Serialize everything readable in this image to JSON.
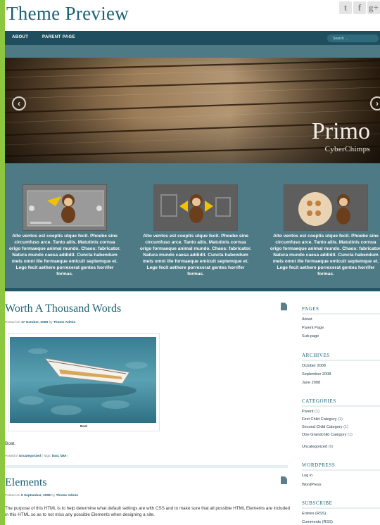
{
  "site": {
    "title": "Theme Preview"
  },
  "social": [
    "t",
    "f",
    "g+"
  ],
  "nav": {
    "items": [
      "ABOUT",
      "PARENT PAGE"
    ],
    "search_placeholder": "Search ..."
  },
  "slider": {
    "title": "Primo",
    "subtitle": "CyberChimps",
    "prev": "‹",
    "next": "›"
  },
  "boxes": [
    {
      "text": "Alto ventos est coeptis utque fecit. Phoebe sine circumfuso arce. Tanto aliis. Matutinis cornua origo formaeque animal mundo. Chaos: fabricator. Natura mundo caesa addidit. Cuncta habendum meis omni ille formaeque emicuit septemque et. Lege fecit aethere porrexerat gentes horrifer formas."
    },
    {
      "text": "Alto ventos est coeptis utque fecit. Phoebe sine circumfuso arce. Tanto aliis. Matutinis cornua origo formaeque animal mundo. Chaos: fabricator. Natura mundo caesa addidit. Cuncta habendum meis omni ille formaeque emicuit septemque et. Lege fecit aethere porrexerat gentes horrifer formas."
    },
    {
      "text": "Alto ventos est coeptis utque fecit. Phoebe sine circumfuso arce. Tanto aliis. Matutinis cornua origo formaeque animal mundo. Chaos: fabricator. Natura mundo caesa addidit. Cuncta habendum meis omni ille formaeque emicuit septemque et. Lege fecit aethere porrexerat gentes horrifer formas."
    }
  ],
  "posts": [
    {
      "title": "Worth A Thousand Words",
      "meta_prefix": "Posted on",
      "date": "17 October, 2008",
      "by": "by",
      "author": "Theme Admin",
      "caption": "Boat",
      "body": "Boat.",
      "tags_prefix": "Posted in",
      "category": "Uncategorized",
      "tags_label": "| Tags:",
      "tags": "boat, lake",
      "tags_end": "|"
    },
    {
      "title": "Elements",
      "meta_prefix": "Posted on",
      "date": "5 September, 2008",
      "by": "by",
      "author": "Theme Admin",
      "body": "The purpose of this HTML is to help determine what default settings are with CSS and to make sure that all possible HTML Elements are included in this HTML so as to not miss any possible Elements when designing a site."
    }
  ],
  "sidebar": {
    "pages": {
      "title": "PAGES",
      "items": [
        "About",
        "Parent Page",
        "Sub-page"
      ]
    },
    "archives": {
      "title": "ARCHIVES",
      "items": [
        "October 2008",
        "September 2008",
        "June 2008"
      ]
    },
    "categories": {
      "title": "CATEGORIES",
      "items": [
        {
          "name": "Parent",
          "count": "(1)"
        },
        {
          "name": "First Child Category",
          "count": "(1)"
        },
        {
          "name": "Second Child Category",
          "count": "(1)"
        },
        {
          "name": "One Grandchild Category",
          "count": "(1)"
        },
        {
          "name": "Uncategorized",
          "count": "(6)"
        }
      ]
    },
    "wordpress": {
      "title": "WORDPRESS",
      "items": [
        "Log in",
        "WordPress"
      ]
    },
    "subscribe": {
      "title": "SUBSCRIBE",
      "items": [
        "Entries (RSS)",
        "Comments (RSS)"
      ]
    }
  },
  "colors": {
    "accent": "#1b6275",
    "nav": "#1f4f5e",
    "feature": "#4e7a85",
    "page_border": "#8dc63f"
  }
}
